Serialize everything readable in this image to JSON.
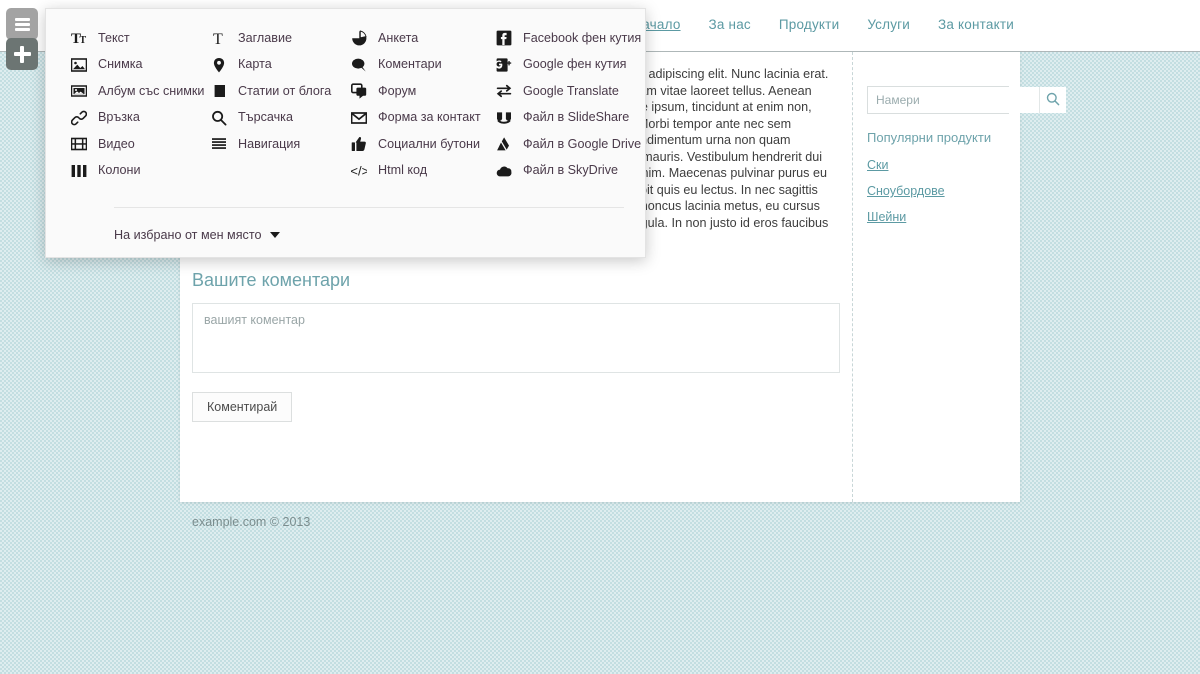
{
  "topnav": {
    "items": [
      {
        "label": "Начало",
        "active": true
      },
      {
        "label": "За нас",
        "active": false
      },
      {
        "label": "Продукти",
        "active": false
      },
      {
        "label": "Услуги",
        "active": false
      },
      {
        "label": "За контакти",
        "active": false
      }
    ]
  },
  "toolbar": {
    "menu_icon": "hamburger-icon",
    "add_icon": "plus-icon"
  },
  "widget_panel": {
    "columns": [
      [
        {
          "icon": "text-icon",
          "label": "Текст"
        },
        {
          "icon": "image-icon",
          "label": "Снимка"
        },
        {
          "icon": "gallery-icon",
          "label": "Албум със снимки"
        },
        {
          "icon": "link-icon",
          "label": "Връзка"
        },
        {
          "icon": "video-icon",
          "label": "Видео"
        },
        {
          "icon": "columns-icon",
          "label": "Колони"
        }
      ],
      [
        {
          "icon": "heading-icon",
          "label": "Заглавие"
        },
        {
          "icon": "map-pin-icon",
          "label": "Карта"
        },
        {
          "icon": "blog-posts-icon",
          "label": "Статии от блога"
        },
        {
          "icon": "search-icon",
          "label": "Търсачка"
        },
        {
          "icon": "navigation-icon",
          "label": "Навигация"
        }
      ],
      [
        {
          "icon": "poll-icon",
          "label": "Анкета"
        },
        {
          "icon": "comments-icon",
          "label": "Коментари"
        },
        {
          "icon": "forum-icon",
          "label": "Форум"
        },
        {
          "icon": "mail-icon",
          "label": "Форма за контакт"
        },
        {
          "icon": "thumbs-up-icon",
          "label": "Социални бутони"
        },
        {
          "icon": "html-code-icon",
          "label": "Html код"
        }
      ],
      [
        {
          "icon": "facebook-icon",
          "label": "Facebook фен кутия"
        },
        {
          "icon": "google-plus-icon",
          "label": "Google фен кутия"
        },
        {
          "icon": "google-translate-icon",
          "label": "Google Translate"
        },
        {
          "icon": "slideshare-icon",
          "label": "Файл в SlideShare"
        },
        {
          "icon": "google-drive-icon",
          "label": "Файл в Google Drive"
        },
        {
          "icon": "skydrive-icon",
          "label": "Файл в SkyDrive"
        }
      ]
    ],
    "footer": {
      "label": "На избрано от мен място",
      "caret_icon": "caret-down-icon"
    }
  },
  "sidebar": {
    "search": {
      "placeholder": "Намери",
      "value": "",
      "button_icon": "search-icon"
    },
    "popular_title": "Популярни продукти",
    "links": [
      {
        "label": "Ски"
      },
      {
        "label": "Сноубордове"
      },
      {
        "label": "Шейни"
      }
    ]
  },
  "content": {
    "image_alt": "mountain-photo",
    "link_text": "acinia erat",
    "paragraph": "Aliquam nisl mi, interdum nec lobortis quis, hendrerit id tortor. Nulla condimentum urna non quam pellentesque scelerisque. Nam eget dolor a turpis tempor vestibulum in faucibus mauris. Vestibulum hendrerit dui arcu, id dignissim augue sagittis id. Donec nec bibendum neque, a consectetur enim. Maecenas pulvinar purus eu rutrum malesuada. Proin non interdum diam. Ut sed magna ac est pulvinar suscipit quis eu lectus. In nec sagittis lectus, eget ornare massa. Aliquam erat volutpat. Sed eget lobortis nunc. Etiam rhoncus lacinia metus, eu cursus arcu. Sed laoreet orci vel dui semper, at rutrum urna dignissim. Quisque vel elit ligula. In non justo id eros faucibus aliquet ut nec mi. Sed eu blandit sapien.",
    "hidden_paragraph_top": "Lorem ipsum dolor sit amet, consectetur adipiscing elit. Nunc lacinia erat. Mauris dui elit, sollicitudin at lacus. Nullam vitae laoreet tellus. Aenean ante felis, mollis nec pellentesque neque ipsum, tincidunt at enim non, consequat mauris. Maecenas gravida rutrum quam, eu rutrum lectus fringilla at. Morbi tempor ante nec sem imperdiet,",
    "comments_title": "Вашите коментари",
    "comment_placeholder": "вашият коментар",
    "comment_value": "",
    "submit_label": "Коментирай"
  },
  "footer": {
    "text": "example.com © 2013"
  },
  "colors": {
    "background": "#c3dee1",
    "accent": "#5c9aa3",
    "panel_bg": "#fafafa",
    "page_bg": "#ffffff",
    "tool_menu": "#a3a3a3",
    "tool_add": "#6c7573"
  }
}
